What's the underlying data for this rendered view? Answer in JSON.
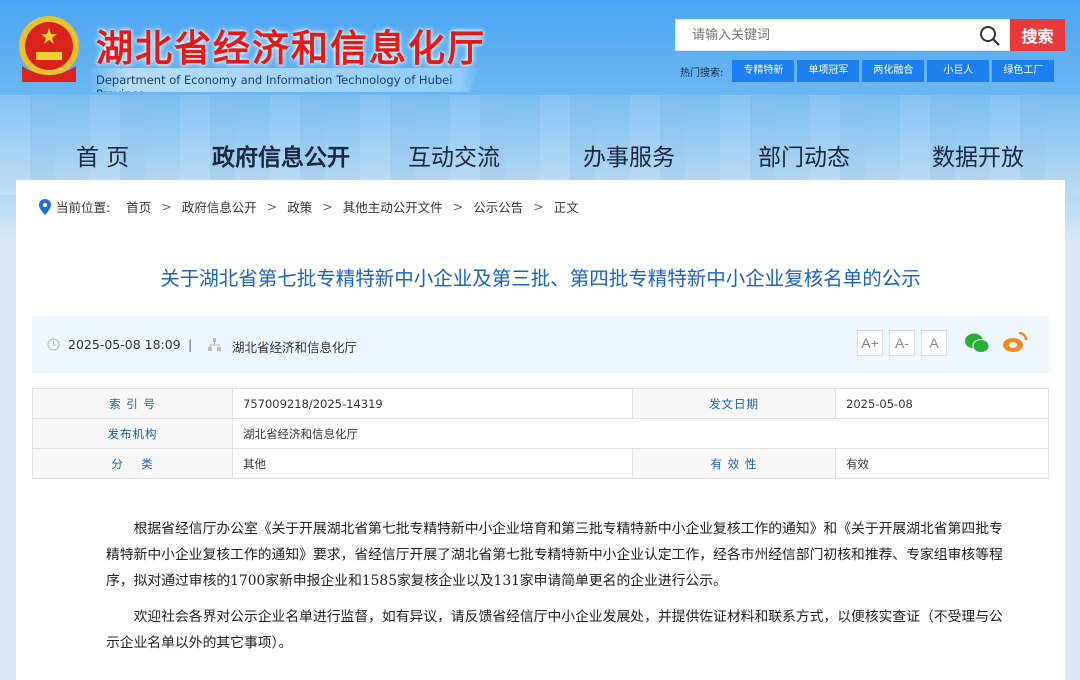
{
  "header": {
    "title_cn": "湖北省经济和信息化厅",
    "title_en": "Department of Economy and Information Technology of Hubei Province",
    "search_placeholder": "请输入关键词",
    "search_button": "搜索",
    "hot_label": "热门搜索:",
    "hot_tags": [
      "专精特新",
      "单项冠军",
      "两化融合",
      "小巨人",
      "绿色工厂"
    ]
  },
  "nav": [
    "首 页",
    "政府信息公开",
    "互动交流",
    "办事服务",
    "部门动态",
    "数据开放"
  ],
  "breadcrumb": {
    "label": "当前位置:",
    "items": [
      "首页",
      "政府信息公开",
      "政策",
      "其他主动公开文件",
      "公示公告",
      "正文"
    ]
  },
  "article": {
    "title": "关于湖北省第七批专精特新中小企业及第三批、第四批专精特新中小企业复核名单的公示",
    "datetime": "2025-05-08 18:09",
    "source": "湖北省经济和信息化厅",
    "font_buttons": [
      "A+",
      "A-",
      "A"
    ],
    "paragraphs": [
      "根据省经信厅办公室《关于开展湖北省第七批专精特新中小企业培育和第三批专精特新中小企业复核工作的通知》和《关于开展湖北省第四批专精特新中小企业复核工作的通知》要求，省经信厅开展了湖北省第七批专精特新中小企业认定工作，经各市州经信部门初核和推荐、专家组审核等程序，拟对通过审核的1700家新申报企业和1585家复核企业以及131家申请简单更名的企业进行公示。",
      "欢迎社会各界对公示企业名单进行监督，如有异议，请反馈省经信厅中小企业发展处，并提供佐证材料和联系方式，以便核实查证（不受理与公示企业名单以外的其它事项）。"
    ]
  },
  "info": {
    "index_label": "索 引 号",
    "index": "757009218/2025-14319",
    "date_label": "发文日期",
    "date": "2025-05-08",
    "org_label": "发布机构",
    "org": "湖北省经济和信息化厅",
    "cat_label": "分　 类",
    "cat": "其他",
    "valid_label": "有 效 性",
    "valid": "有效"
  },
  "colors": {
    "accent": "#1a63c4",
    "search": "#e83a3a",
    "tag": "#1d7ff0",
    "title": "#e31a1a"
  }
}
